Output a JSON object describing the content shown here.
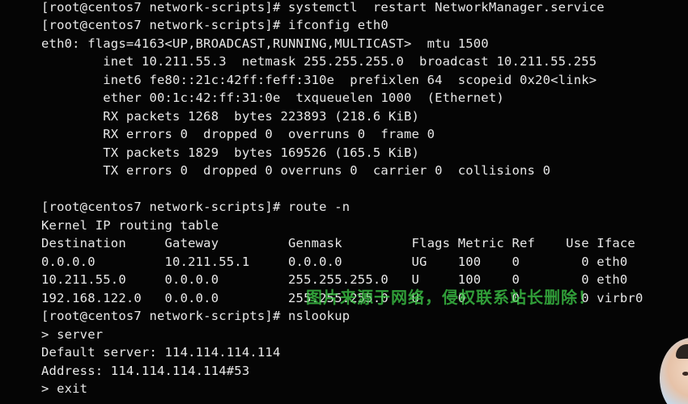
{
  "terminal": {
    "lines": [
      "[root@centos7 network-scripts]# systemctl  restart NetworkManager.service",
      "[root@centos7 network-scripts]# ifconfig eth0",
      "eth0: flags=4163<UP,BROADCAST,RUNNING,MULTICAST>  mtu 1500",
      "        inet 10.211.55.3  netmask 255.255.255.0  broadcast 10.211.55.255",
      "        inet6 fe80::21c:42ff:feff:310e  prefixlen 64  scopeid 0x20<link>",
      "        ether 00:1c:42:ff:31:0e  txqueuelen 1000  (Ethernet)",
      "        RX packets 1268  bytes 223893 (218.6 KiB)",
      "        RX errors 0  dropped 0  overruns 0  frame 0",
      "        TX packets 1829  bytes 169526 (165.5 KiB)",
      "        TX errors 0  dropped 0 overruns 0  carrier 0  collisions 0",
      "",
      "[root@centos7 network-scripts]# route -n",
      "Kernel IP routing table",
      "Destination     Gateway         Genmask         Flags Metric Ref    Use Iface",
      "0.0.0.0         10.211.55.1     0.0.0.0         UG    100    0        0 eth0",
      "10.211.55.0     0.0.0.0         255.255.255.0   U     100    0        0 eth0",
      "192.168.122.0   0.0.0.0         255.255.255.0   U     0      0        0 virbr0",
      "[root@centos7 network-scripts]# nslookup",
      "> server",
      "Default server: 114.114.114.114",
      "Address: 114.114.114.114#53",
      "> exit"
    ]
  },
  "watermark": {
    "text": "图片来源于网络，侵权联系站长删除！"
  },
  "colors": {
    "background": "#050505",
    "text": "#e8e8e8",
    "watermark": "#3cc846"
  }
}
